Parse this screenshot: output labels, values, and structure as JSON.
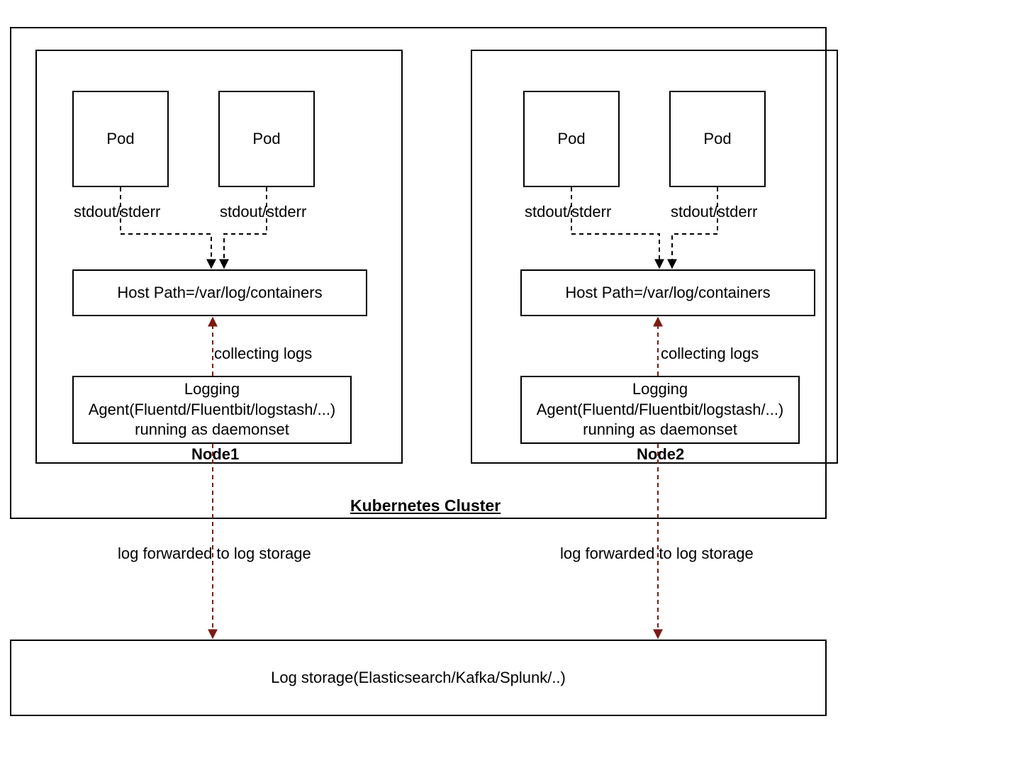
{
  "labels": {
    "pod": "Pod",
    "stdout": "stdout/stderr",
    "hostpath": "Host Path=/var/log/containers",
    "collecting": "collecting logs",
    "agent": "Logging\nAgent(Fluentd/Fluentbit/logstash/...)\nrunning as daemonset",
    "node1": "Node1",
    "node2": "Node2",
    "cluster": "Kubernetes Cluster",
    "forward": "log forwarded to log storage",
    "storage": "Log storage(Elasticsearch/Kafka/Splunk/..)"
  },
  "colors": {
    "black": "#000000",
    "darkred": "#7b1a13"
  }
}
